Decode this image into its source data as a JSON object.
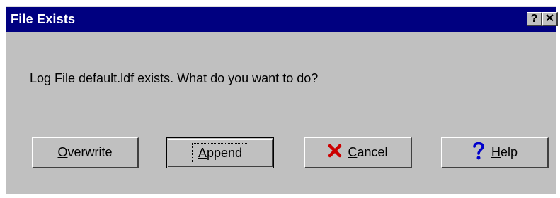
{
  "window": {
    "title": "File Exists",
    "help_button": "?",
    "close_button": "✕"
  },
  "message": "Log File default.ldf exists.  What do you want to do?",
  "buttons": {
    "overwrite": {
      "first": "O",
      "rest": "verwrite"
    },
    "append": {
      "first": "A",
      "rest": "ppend"
    },
    "cancel": {
      "first": "C",
      "rest": "ancel",
      "icon": "red-x-icon"
    },
    "help": {
      "first": "H",
      "rest": "elp",
      "icon": "question-mark-icon"
    }
  },
  "colors": {
    "titlebar": "#000080",
    "face": "#c0c0c0",
    "cancel_icon": "#cc0000",
    "help_icon": "#0000cc"
  }
}
